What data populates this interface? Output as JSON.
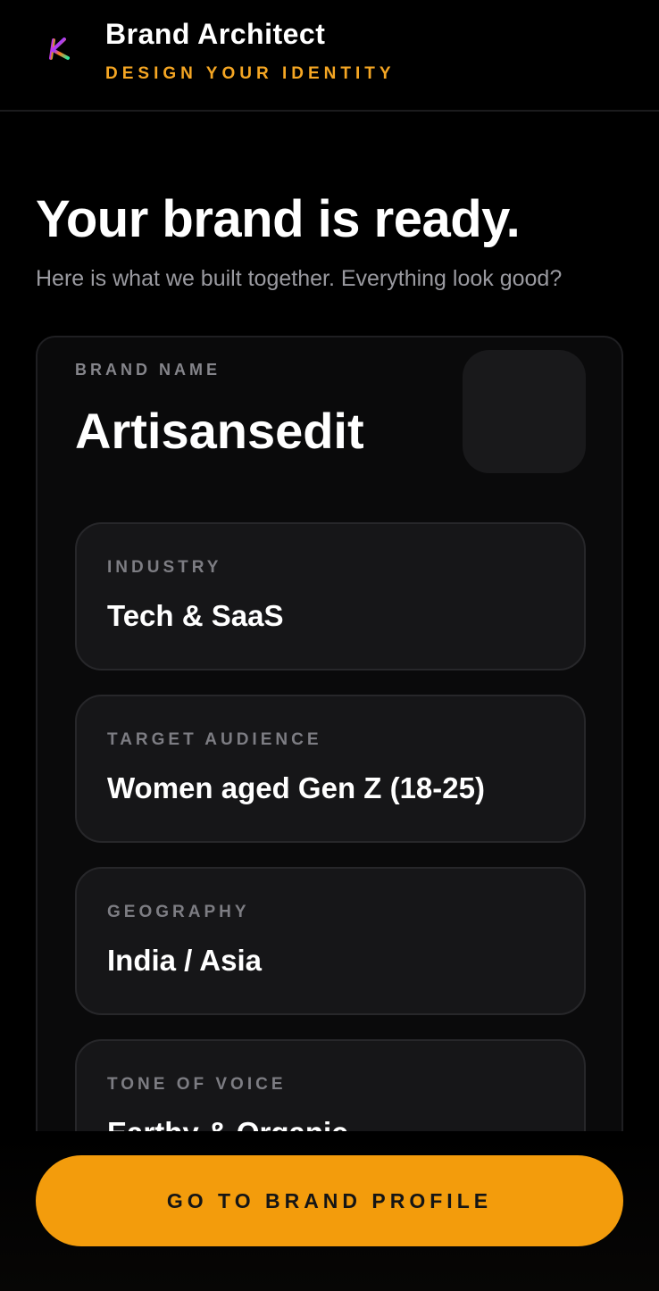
{
  "header": {
    "logo_icon": "k-logo-icon",
    "title": "Brand Architect",
    "subtitle": "DESIGN YOUR IDENTITY",
    "accent_color": "#f5a623"
  },
  "hero": {
    "title": "Your brand is ready.",
    "subtitle": "Here is what we built together. Everything look good?"
  },
  "summary": {
    "brand_name_label": "BRAND NAME",
    "brand_name": "Artisansedit",
    "fields": [
      {
        "label": "INDUSTRY",
        "value": "Tech & SaaS"
      },
      {
        "label": "TARGET AUDIENCE",
        "value": "Women aged Gen Z (18-25)"
      },
      {
        "label": "GEOGRAPHY",
        "value": "India / Asia"
      },
      {
        "label": "TONE OF VOICE",
        "value": "Earthy & Organic"
      }
    ]
  },
  "cta": {
    "label": "GO TO BRAND PROFILE",
    "color": "#f39c0c"
  }
}
